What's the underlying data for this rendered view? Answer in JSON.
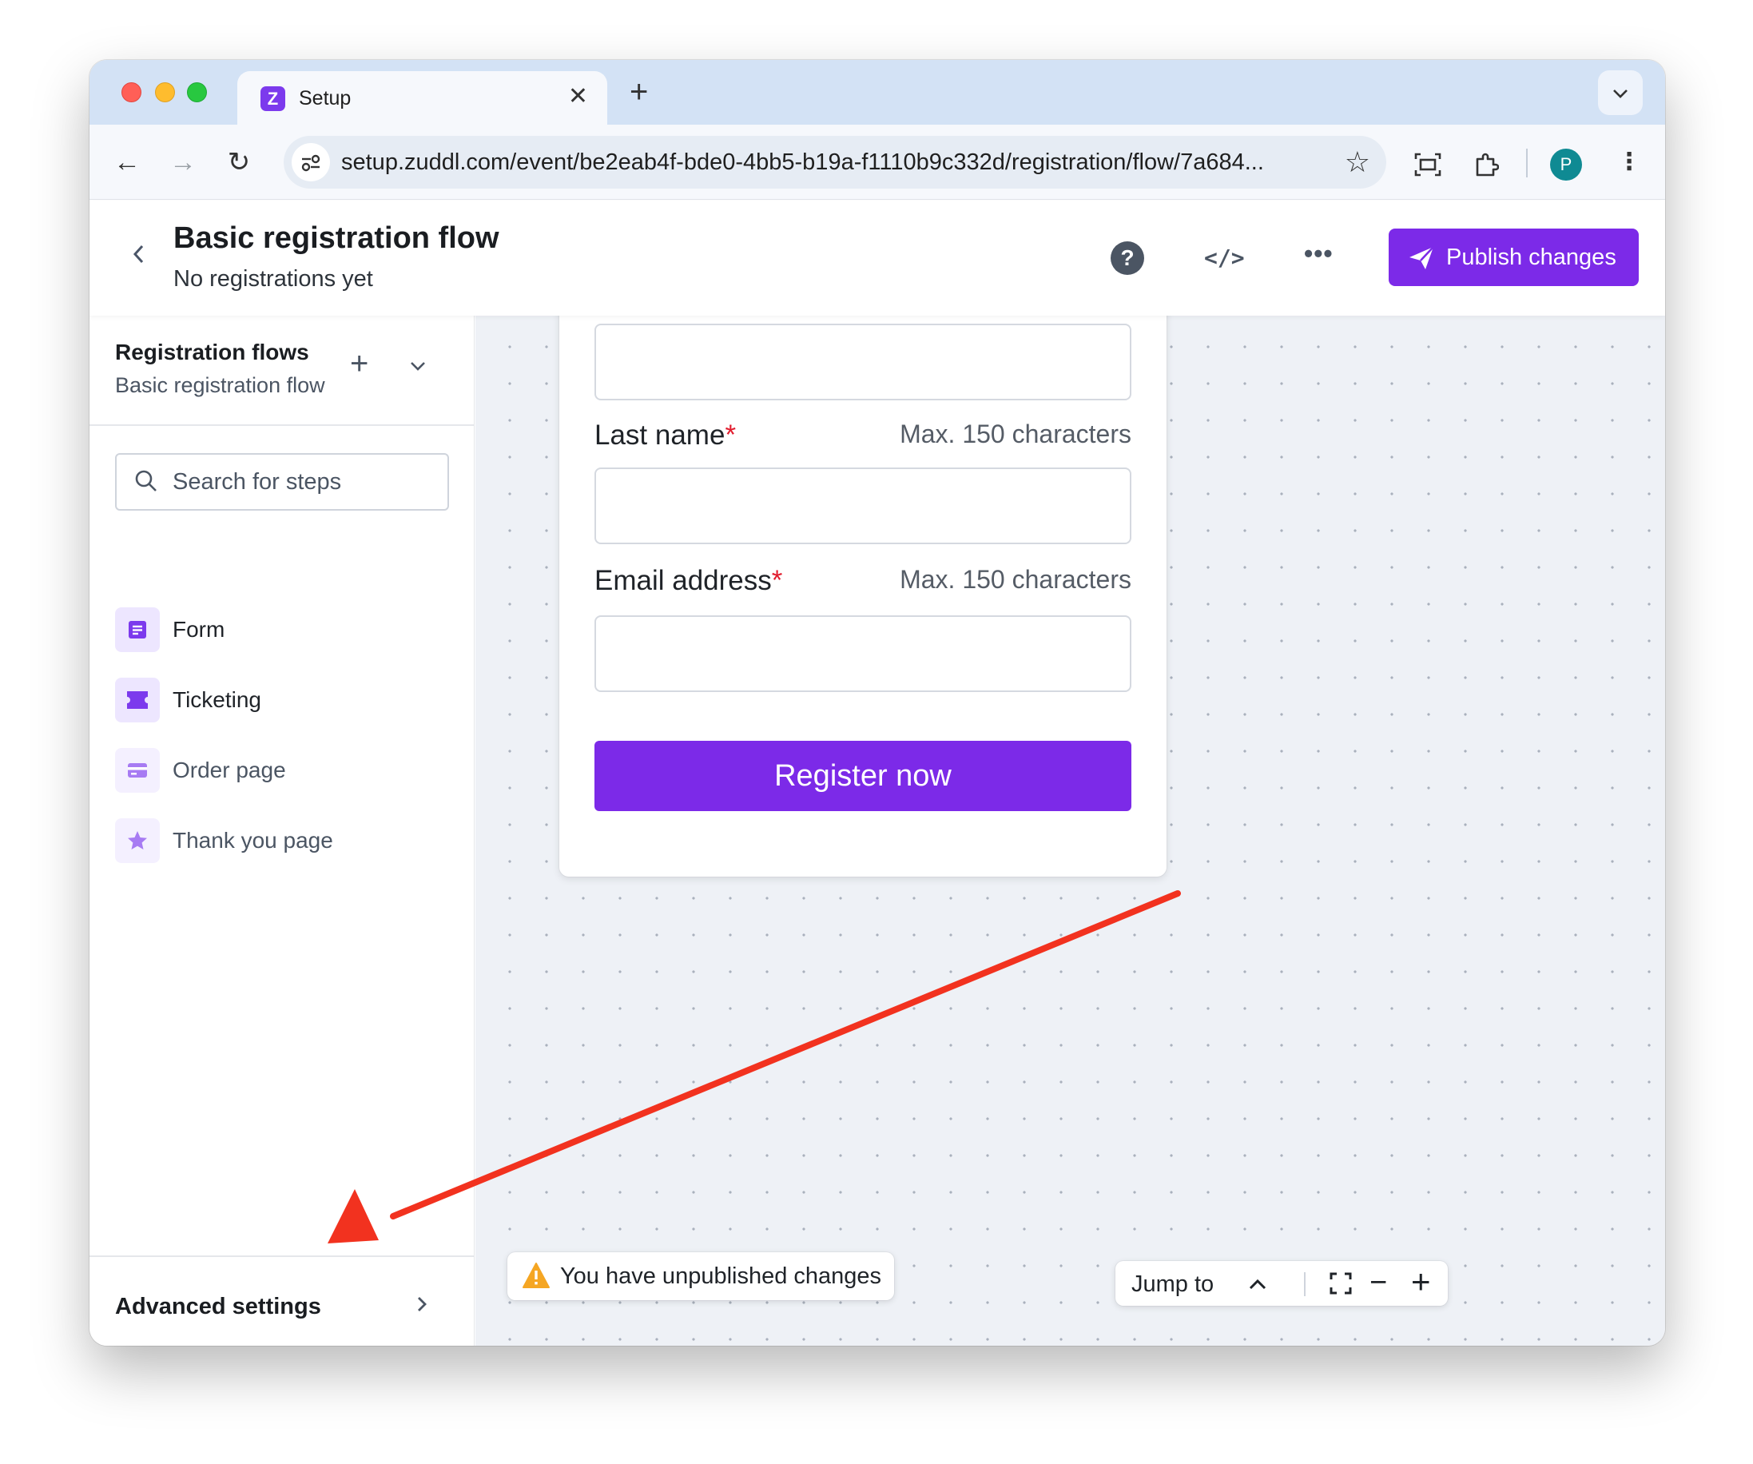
{
  "browser": {
    "tab_title": "Setup",
    "tab_favicon_letter": "Z",
    "url": "setup.zuddl.com/event/be2eab4f-bde0-4bb5-b19a-f1110b9c332d/registration/flow/7a684...",
    "profile_initial": "P"
  },
  "header": {
    "title": "Basic registration flow",
    "subtitle": "No registrations yet",
    "publish_label": "Publish changes"
  },
  "sidebar": {
    "flows_title": "Registration flows",
    "flows_current": "Basic registration flow",
    "search_placeholder": "Search for steps",
    "steps": [
      {
        "label": "Form",
        "icon": "form-icon"
      },
      {
        "label": "Ticketing",
        "icon": "ticket-icon"
      },
      {
        "label": "Order page",
        "icon": "card-icon"
      },
      {
        "label": "Thank you page",
        "icon": "star-icon"
      }
    ],
    "advanced_label": "Advanced settings"
  },
  "form": {
    "fields": [
      {
        "label": "Last name",
        "required_mark": "*",
        "hint": "Max. 150 characters"
      },
      {
        "label": "Email address",
        "required_mark": "*",
        "hint": "Max. 150 characters"
      }
    ],
    "submit_label": "Register now"
  },
  "canvas": {
    "unpublished_notice": "You have unpublished changes",
    "jump_label": "Jump to"
  },
  "colors": {
    "brand_purple": "#7c2ae8",
    "required_red": "#e11d2e",
    "annotation_red": "#f2321f",
    "warning_amber": "#f5a623"
  }
}
